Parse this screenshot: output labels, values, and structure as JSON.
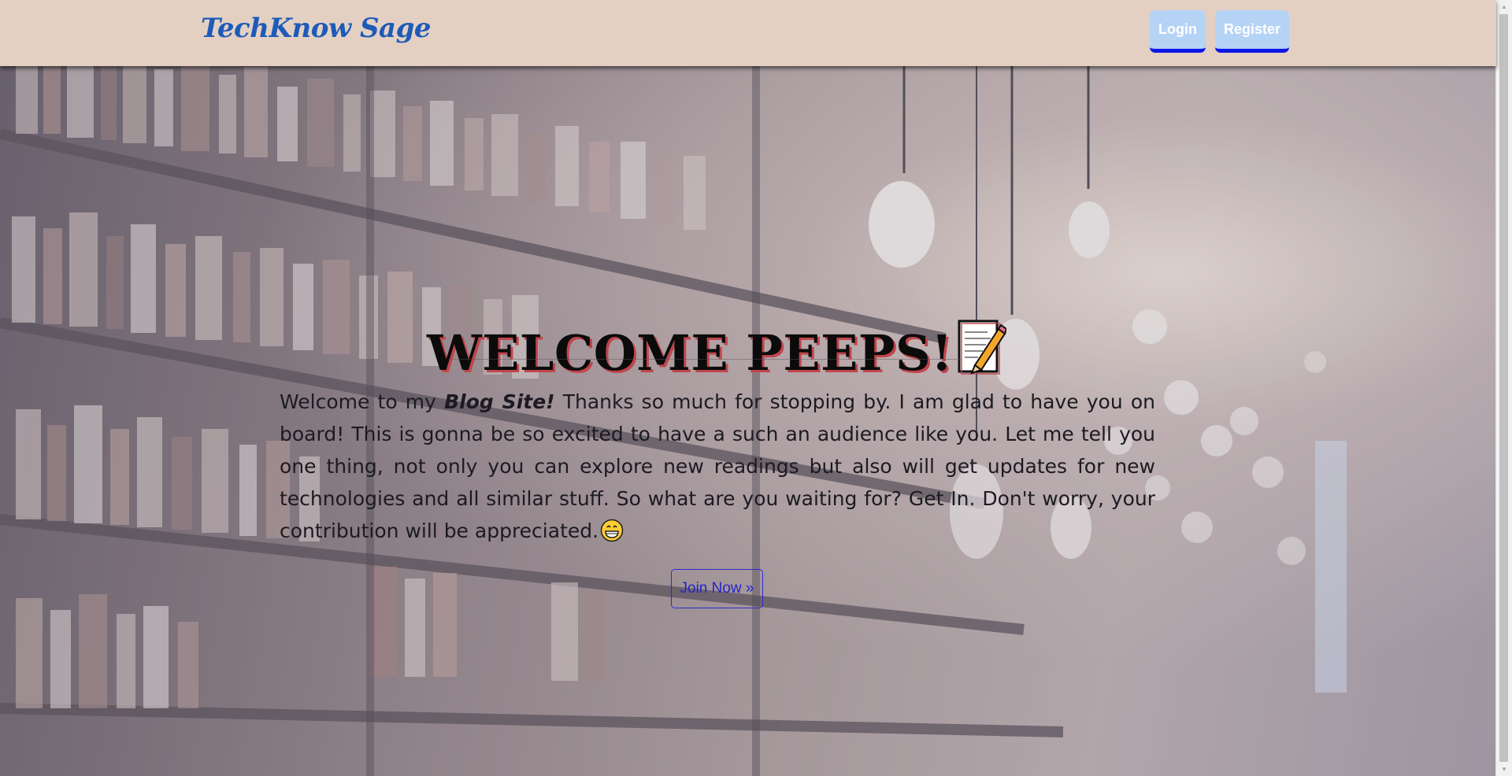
{
  "navbar": {
    "brand": "TechKnow Sage",
    "login_label": "Login",
    "register_label": "Register"
  },
  "hero": {
    "title": "WELCOME PEEPS!",
    "title_icon": "memo-icon",
    "paragraph": {
      "part1": "Welcome to my ",
      "emphasis": "Blog Site!",
      "part2": " Thanks so much for stopping by. I am glad to have you on board! This is gonna be so excited to have a such an audience like you. Let me tell you one thing, not only you can explore new readings but also will get updates for new technologies and all similar stuff. So what are you waiting for? Get In. Don't worry, your contribution will be appreciated.",
      "trailing_icon": "grinning-face-icon"
    },
    "join_label": "Join Now »"
  },
  "colors": {
    "navbar_bg": "#e3d0c3",
    "brand": "#1d5bb8",
    "nav_button_bg": "#b5d3f5",
    "nav_button_border": "#0d17e6",
    "title_shadow": "#c0454b",
    "join_button": "#2525c8"
  },
  "background_image": "library-bookshelves-with-hanging-light-bulbs"
}
